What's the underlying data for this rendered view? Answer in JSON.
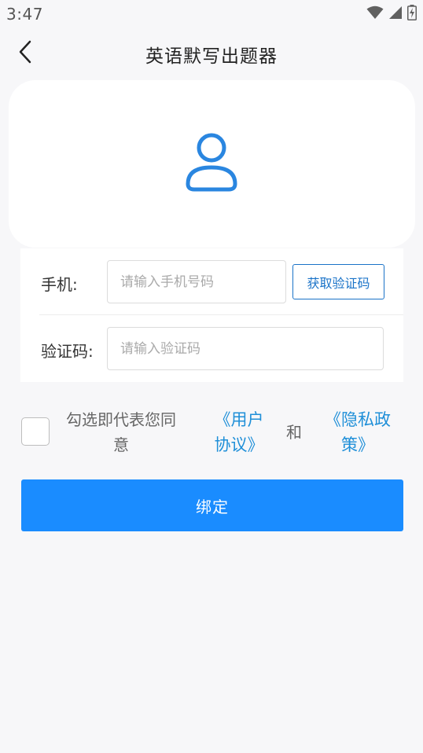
{
  "status_bar": {
    "time": "3:47",
    "icons": [
      "wifi-icon",
      "signal-icon",
      "battery-icon"
    ]
  },
  "header": {
    "back_icon": "chevron-left-icon",
    "title": "英语默写出题器"
  },
  "avatar": {
    "icon": "user-icon",
    "accent_color": "#2a86e0"
  },
  "form": {
    "phone_label": "手机:",
    "phone_value": "",
    "phone_placeholder": "请输入手机号码",
    "get_code_label": "获取验证码",
    "code_label": "验证码:",
    "code_value": "",
    "code_placeholder": "请输入验证码"
  },
  "agreement": {
    "checked": false,
    "text": "勾选即代表您同意",
    "user_agreement": "《用户协议》",
    "and": "和",
    "privacy_policy": "《隐私政策》"
  },
  "bind_button": {
    "label": "绑定",
    "color": "#1a8cff"
  }
}
